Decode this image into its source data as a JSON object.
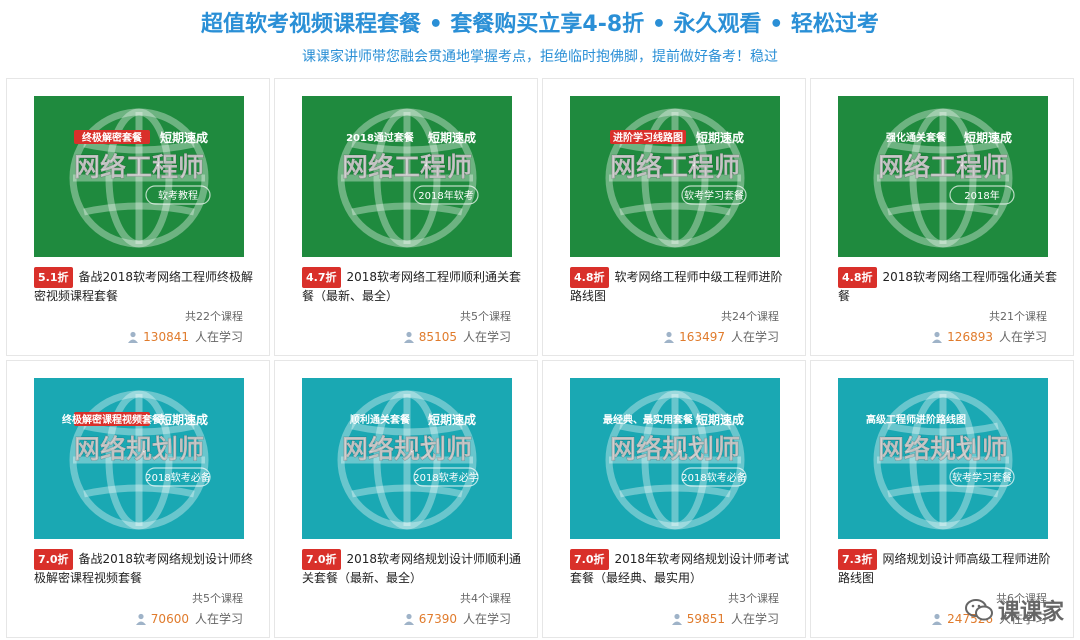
{
  "header": {
    "title": "超值软考视频课程套餐 • 套餐购买立享4-8折 • 永久观看 • 轻松过考",
    "subtitle": "课课家讲师带您融会贯通地掌握考点，拒绝临时抱佛脚，提前做好备考！稳过"
  },
  "colors": {
    "accent": "#2a8fd6",
    "green": "#1f8a3e",
    "teal": "#1aa8b3",
    "tag": "#d9302a",
    "learn_num": "#e07b2c"
  },
  "cards": [
    {
      "tag": "5.1折",
      "name": "备战2018软考网络工程师终极解密视频课程套餐",
      "count": "共22个课程",
      "learn_num": "130841",
      "learn_suffix": "人在学习",
      "thumb": {
        "bg": "#1f8a3e",
        "top_badge": "终极解密套餐",
        "top_badge_style": "red",
        "top_right": "短期速成",
        "main": "网络工程师",
        "sub": "软考教程"
      }
    },
    {
      "tag": "4.7折",
      "name": "2018软考网络工程师顺利通关套餐（最新、最全）",
      "count": "共5个课程",
      "learn_num": "85105",
      "learn_suffix": "人在学习",
      "thumb": {
        "bg": "#1f8a3e",
        "top_badge": "2018通过套餐",
        "top_badge_style": "plain",
        "top_right": "短期速成",
        "main": "网络工程师",
        "sub": "2018年软考"
      }
    },
    {
      "tag": "4.8折",
      "name": "软考网络工程师中级工程师进阶路线图",
      "count": "共24个课程",
      "learn_num": "163497",
      "learn_suffix": "人在学习",
      "thumb": {
        "bg": "#1f8a3e",
        "top_badge": "进阶学习线路图",
        "top_badge_style": "red",
        "top_right": "短期速成",
        "main": "网络工程师",
        "sub": "软考学习套餐"
      }
    },
    {
      "tag": "4.8折",
      "name": "2018软考网络工程师强化通关套餐",
      "count": "共21个课程",
      "learn_num": "126893",
      "learn_suffix": "人在学习",
      "thumb": {
        "bg": "#1f8a3e",
        "top_badge": "强化通关套餐",
        "top_badge_style": "plain",
        "top_right": "短期速成",
        "main": "网络工程师",
        "sub": "2018年"
      }
    },
    {
      "tag": "7.0折",
      "name": "备战2018软考网络规划设计师终极解密课程视频套餐",
      "count": "共5个课程",
      "learn_num": "70600",
      "learn_suffix": "人在学习",
      "thumb": {
        "bg": "#1aa8b3",
        "top_badge": "终极解密课程视频套餐",
        "top_badge_style": "red",
        "top_right": "短期速成",
        "main": "网络规划师",
        "sub": "2018软考必备"
      }
    },
    {
      "tag": "7.0折",
      "name": "2018软考网络规划设计师顺利通关套餐（最新、最全）",
      "count": "共4个课程",
      "learn_num": "67390",
      "learn_suffix": "人在学习",
      "thumb": {
        "bg": "#1aa8b3",
        "top_badge": "顺利通关套餐",
        "top_badge_style": "plain",
        "top_right": "短期速成",
        "main": "网络规划师",
        "sub": "2018软考必学"
      }
    },
    {
      "tag": "7.0折",
      "name": "2018年软考网络规划设计师考试套餐（最经典、最实用）",
      "count": "共3个课程",
      "learn_num": "59851",
      "learn_suffix": "人在学习",
      "thumb": {
        "bg": "#1aa8b3",
        "top_badge": "最经典、最实用套餐",
        "top_badge_style": "plain",
        "top_right": "短期速成",
        "main": "网络规划师",
        "sub": "2018软考必备"
      }
    },
    {
      "tag": "7.3折",
      "name": "网络规划设计师高级工程师进阶路线图",
      "count": "共6个课程",
      "learn_num": "247526",
      "learn_suffix": "人在学习",
      "thumb": {
        "bg": "#1aa8b3",
        "top_badge": "高级工程师进阶路线图",
        "top_badge_style": "plain",
        "top_right": "",
        "main": "网络规划师",
        "sub": "软考学习套餐"
      }
    }
  ],
  "watermark": {
    "text": "课课家",
    "icon": "wechat-icon"
  }
}
